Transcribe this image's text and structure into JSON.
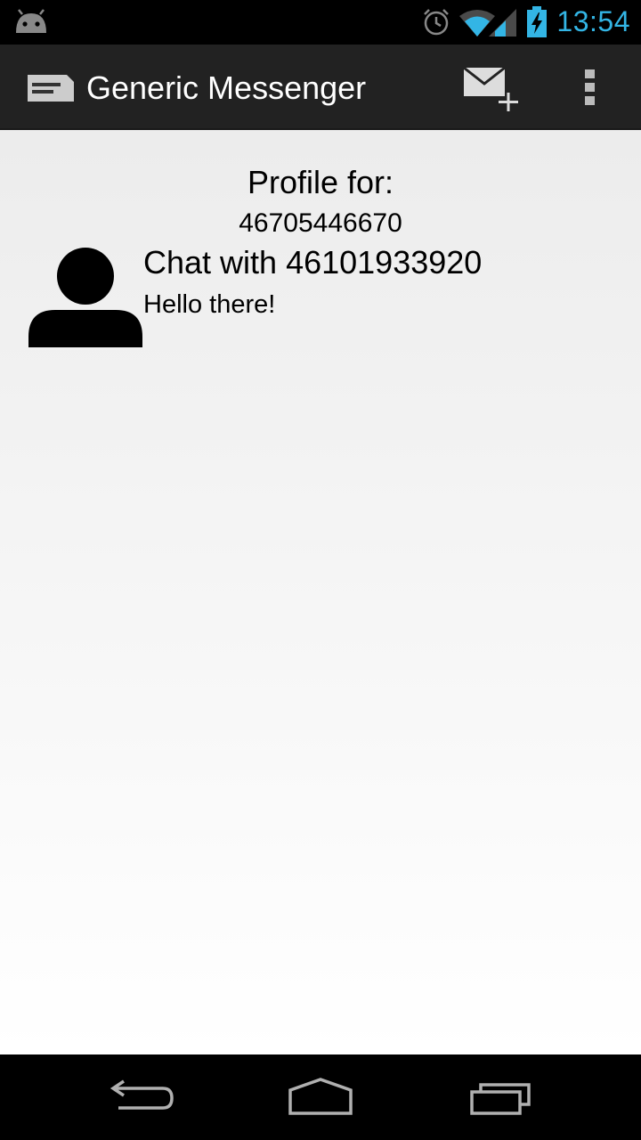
{
  "status_bar": {
    "time": "13:54",
    "icons": [
      "android-notification-icon",
      "alarm-icon",
      "wifi-icon",
      "signal-icon",
      "battery-charging-icon"
    ]
  },
  "action_bar": {
    "title": "Generic Messenger",
    "icons": [
      "app-messenger-icon",
      "new-message-icon",
      "overflow-menu-icon"
    ]
  },
  "profile": {
    "label": "Profile for:",
    "number": "46705446670"
  },
  "chats": [
    {
      "title": "Chat with 46101933920",
      "preview": "Hello there!",
      "avatar_icon": "person-avatar-icon"
    }
  ],
  "nav_bar": {
    "icons": [
      "back-icon",
      "home-icon",
      "recent-apps-icon"
    ]
  },
  "colors": {
    "accent": "#33b5e5",
    "action_bar": "#222222"
  }
}
